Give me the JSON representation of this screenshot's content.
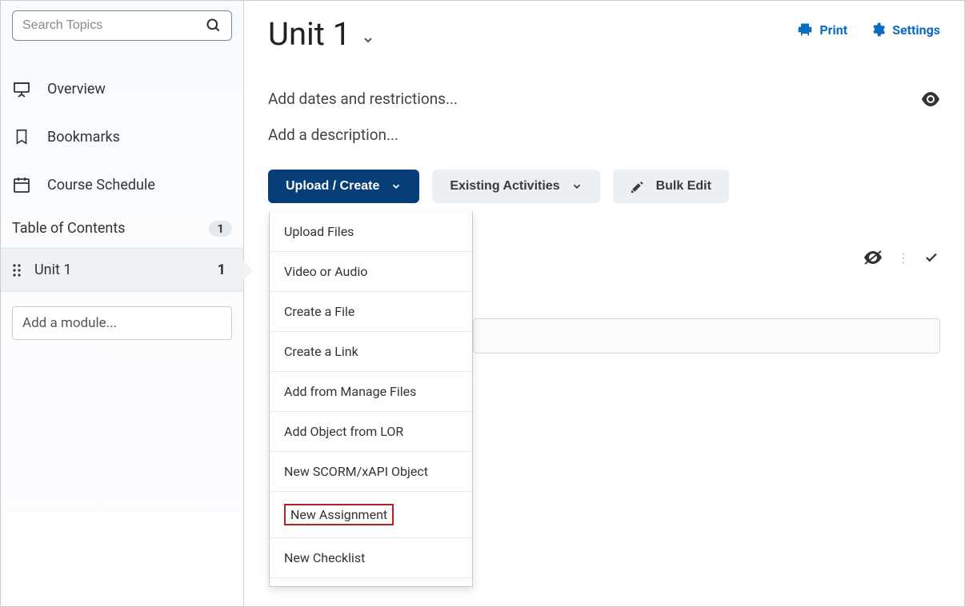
{
  "sidebar": {
    "search_placeholder": "Search Topics",
    "nav": [
      {
        "label": "Overview"
      },
      {
        "label": "Bookmarks"
      },
      {
        "label": "Course Schedule"
      }
    ],
    "toc_label": "Table of Contents",
    "toc_count": "1",
    "unit_label": "Unit 1",
    "unit_count": "1",
    "add_module_placeholder": "Add a module..."
  },
  "header": {
    "title": "Unit 1",
    "print_label": "Print",
    "settings_label": "Settings"
  },
  "main": {
    "dates_label": "Add dates and restrictions...",
    "description_label": "Add a description...",
    "upload_create_label": "Upload / Create",
    "existing_activities_label": "Existing Activities",
    "bulk_edit_label": "Bulk Edit"
  },
  "dropdown": {
    "items": [
      "Upload Files",
      "Video or Audio",
      "Create a File",
      "Create a Link",
      "Add from Manage Files",
      "Add Object from LOR",
      "New SCORM/xAPI Object",
      "New Assignment",
      "New Checklist"
    ],
    "highlighted_index": 7
  },
  "colors": {
    "primary": "#063e77",
    "link": "#0b6cbf",
    "highlight_box": "#b22222"
  }
}
